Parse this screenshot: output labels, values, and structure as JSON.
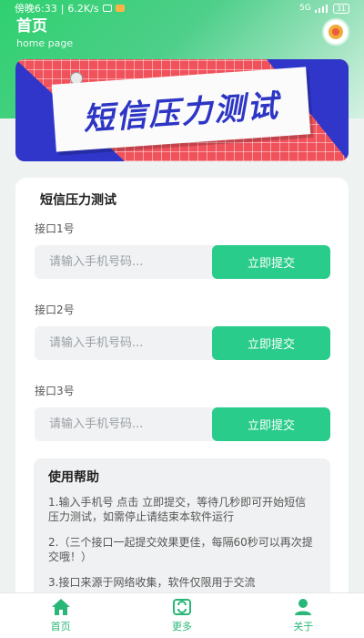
{
  "status_bar": {
    "time": "傍晚6:33",
    "speed": "6.2K/s",
    "network": "5G",
    "battery": "31"
  },
  "header": {
    "title": "首页",
    "subtitle": "home page"
  },
  "banner": {
    "text": "短信压力测试",
    "colors": {
      "red": "#f0525c",
      "blue": "#2f36c9"
    }
  },
  "card": {
    "title": "短信压力测试",
    "ports": [
      {
        "label": "接口1号",
        "placeholder": "请输入手机号码...",
        "button": "立即提交"
      },
      {
        "label": "接口2号",
        "placeholder": "请输入手机号码...",
        "button": "立即提交"
      },
      {
        "label": "接口3号",
        "placeholder": "请输入手机号码...",
        "button": "立即提交"
      }
    ]
  },
  "help": {
    "title": "使用帮助",
    "items": [
      "1.输入手机号 点击 立即提交，等待几秒即可开始短信压力测试，如需停止请结束本软件运行",
      "2.（三个接口一起提交效果更佳，每隔60秒可以再次提交哦！）",
      "3.接口来源于网络收集，软件仅限用于交流"
    ]
  },
  "tabs": [
    {
      "label": "首页",
      "icon": "home-icon"
    },
    {
      "label": "更多",
      "icon": "refresh-icon"
    },
    {
      "label": "关于",
      "icon": "user-icon"
    }
  ],
  "accent_color": "#29cc8a"
}
